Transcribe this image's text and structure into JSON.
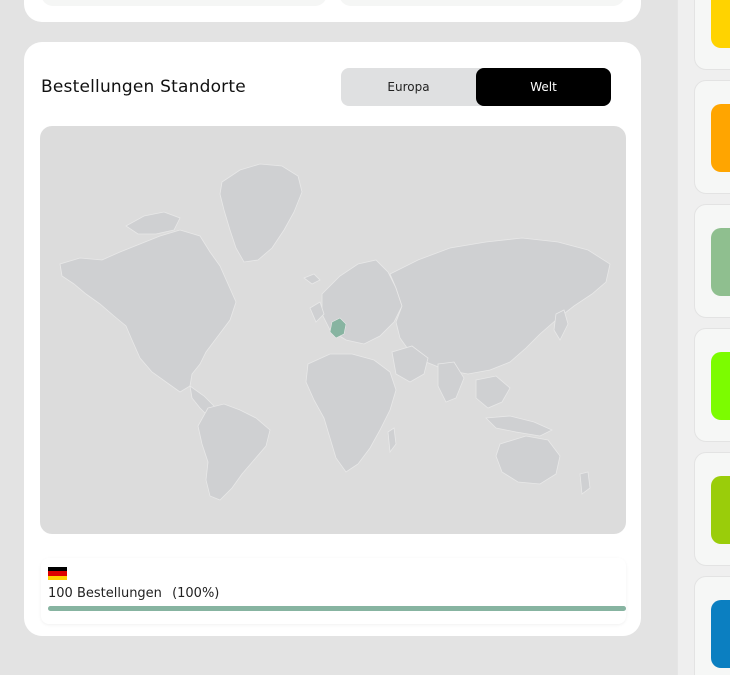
{
  "section": {
    "title": "Bestellungen Standorte",
    "toggle": {
      "europe_label": "Europa",
      "world_label": "Welt",
      "active": "Welt"
    }
  },
  "map": {
    "land_color": "#cfd0d2",
    "highlight_color": "#87b4a1",
    "highlighted_country": "Deutschland"
  },
  "stats": {
    "country_flag": "flag-germany-icon",
    "orders_text": "100 Bestellungen",
    "percent_text": "(100%)",
    "share": 1.0
  },
  "side_cards": [
    {
      "color": "#ffd300",
      "label": ""
    },
    {
      "color": "#ffa500",
      "label": ""
    },
    {
      "color": "#8fbf8f",
      "label": ""
    },
    {
      "color": "#7cfc00",
      "label": ""
    },
    {
      "color": "#9acd0a",
      "label": ""
    },
    {
      "color": "#0b7fc1",
      "label": ""
    }
  ]
}
